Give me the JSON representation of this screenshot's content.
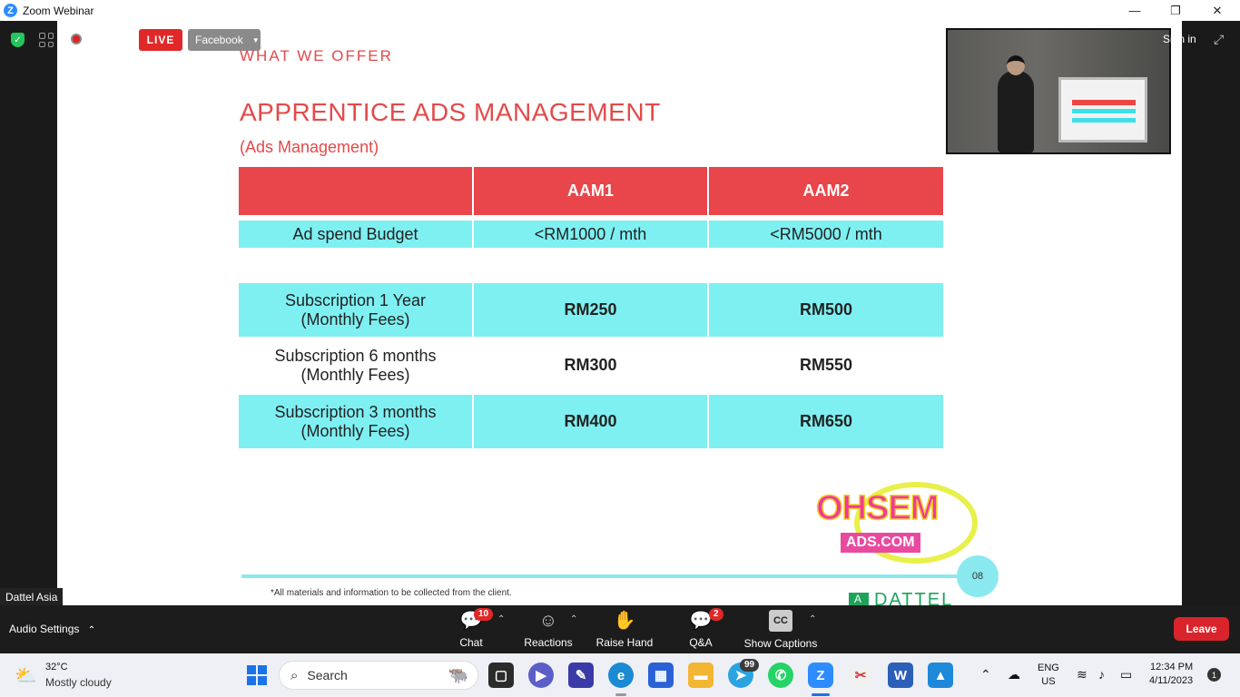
{
  "window": {
    "title": "Zoom Webinar",
    "app_icon": "Z",
    "minimize": "—",
    "restore": "❐",
    "close": "✕"
  },
  "top_controls": {
    "live_label": "LIVE",
    "stream_target": "Facebook",
    "sign_in": "Sign in"
  },
  "slide": {
    "section": "WHAT WE OFFER",
    "title": "APPRENTICE ADS MANAGEMENT",
    "subtitle": "(Ads Management)",
    "table": {
      "headers": [
        "",
        "AAM1",
        "AAM2"
      ],
      "budget_row": [
        "Ad spend Budget",
        "<RM1000 / mth",
        "<RM5000 / mth"
      ],
      "rows": [
        {
          "label_1": "Subscription 1 Year",
          "label_2": "(Monthly Fees)",
          "aam1": "RM250",
          "aam2": "RM500"
        },
        {
          "label_1": "Subscription 6 months",
          "label_2": "(Monthly Fees)",
          "aam1": "RM300",
          "aam2": "RM550"
        },
        {
          "label_1": "Subscription 3 months",
          "label_2": "(Monthly Fees)",
          "aam1": "RM400",
          "aam2": "RM650"
        }
      ]
    },
    "logo": {
      "word": "OHSEM",
      "domain": "ADS.COM"
    },
    "page_number": "08",
    "footnote_1": "*All materials and information to be collected from the client.",
    "footnote_2": "",
    "brand": "DATTEL"
  },
  "participant_name": "Dattel Asia",
  "toolbar": {
    "audio_settings": "Audio Settings",
    "chat": {
      "label": "Chat",
      "badge": "10"
    },
    "reactions": {
      "label": "Reactions"
    },
    "raise_hand": {
      "label": "Raise Hand"
    },
    "qa": {
      "label": "Q&A",
      "badge": "2"
    },
    "captions": {
      "label": "Show Captions",
      "icon_text": "CC"
    },
    "leave": "Leave"
  },
  "taskbar": {
    "weather_temp": "32°C",
    "weather_desc": "Mostly cloudy",
    "search_placeholder": "Search",
    "telegram_badge": "99",
    "lang_1": "ENG",
    "lang_2": "US",
    "time": "12:34 PM",
    "date": "4/11/2023",
    "notifications": "1"
  },
  "colors": {
    "accent_red": "#e8464a",
    "cyan": "#7ef0f2",
    "zoom_blue": "#2D8CFF",
    "leave_red": "#d9242b"
  }
}
